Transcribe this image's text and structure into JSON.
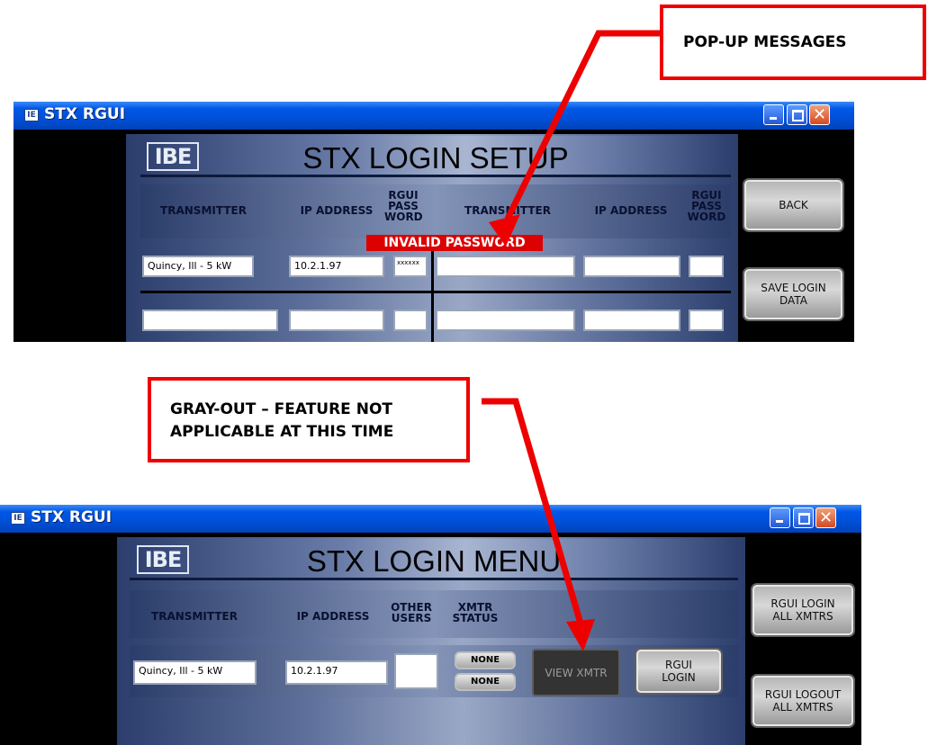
{
  "callouts": {
    "popup_messages": "POP-UP MESSAGES",
    "grayout_line1": "GRAY-OUT – FEATURE NOT",
    "grayout_line2": "APPLICABLE AT THIS TIME"
  },
  "window1": {
    "title": "STX RGUI",
    "logo": "IBE",
    "banner_title": "STX LOGIN SETUP",
    "headers": {
      "transmitter": "TRANSMITTER",
      "ip_address": "IP ADDRESS",
      "rgui_1": "RGUI",
      "rgui_2": "PASS",
      "rgui_3": "WORD",
      "transmitter_right": "TRANSMITTER"
    },
    "popup": "INVALID PASSWORD",
    "row1": {
      "transmitter": "Quincy, Ill - 5 kW",
      "ip": "10.2.1.97",
      "password": "xxxxxx"
    },
    "buttons": {
      "back": "BACK",
      "save_1": "SAVE LOGIN",
      "save_2": "DATA"
    }
  },
  "window2": {
    "title": "STX RGUI",
    "logo": "IBE",
    "banner_title": "STX LOGIN MENU",
    "headers": {
      "transmitter": "TRANSMITTER",
      "ip_address": "IP ADDRESS",
      "other_1": "OTHER",
      "other_2": "USERS",
      "xmtr_1": "XMTR",
      "xmtr_2": "STATUS"
    },
    "row1": {
      "transmitter": "Quincy, Ill - 5 kW",
      "ip": "10.2.1.97",
      "status_1": "NONE",
      "status_2": "NONE"
    },
    "buttons": {
      "view_xmtr": "VIEW XMTR",
      "rgui_login_1": "RGUI",
      "rgui_login_2": "LOGIN",
      "login_all_1": "RGUI LOGIN",
      "login_all_2": "ALL XMTRS",
      "logout_all_1": "RGUI LOGOUT",
      "logout_all_2": "ALL XMTRS"
    }
  },
  "colors": {
    "callout": "#ee0000",
    "titlebar": "#0058e6",
    "popup": "#dd0000"
  }
}
